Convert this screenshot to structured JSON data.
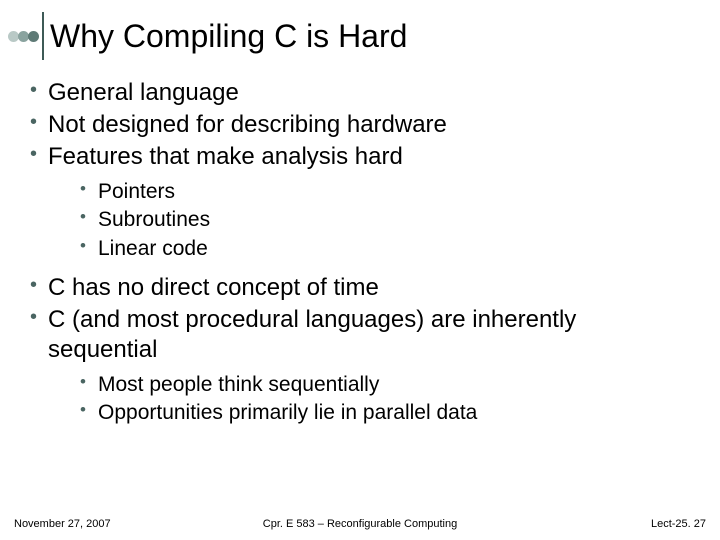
{
  "title": "Why Compiling C is Hard",
  "bullets": {
    "b0": "General language",
    "b1": "Not designed for describing hardware",
    "b2": "Features that make analysis hard",
    "b3": "C has no direct concept of time",
    "b4": "C (and most procedural languages) are inherently sequential"
  },
  "sub1": {
    "s0": "Pointers",
    "s1": "Subroutines",
    "s2": "Linear code"
  },
  "sub2": {
    "s0": "Most people think sequentially",
    "s1": "Opportunities primarily lie in parallel data"
  },
  "footer": {
    "date": "November 27, 2007",
    "course": "Cpr. E 583 – Reconfigurable Computing",
    "page": "Lect-25. 27"
  }
}
